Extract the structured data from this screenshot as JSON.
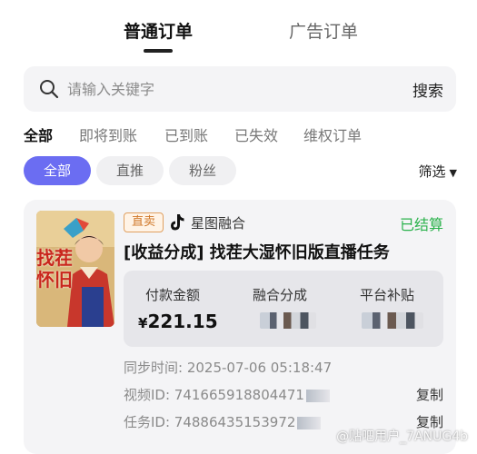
{
  "top_tabs": [
    {
      "label": "普通订单",
      "active": true
    },
    {
      "label": "广告订单",
      "active": false
    }
  ],
  "search": {
    "placeholder": "请输入关键字",
    "button_label": "搜索"
  },
  "status_tabs": [
    {
      "label": "全部",
      "active": true
    },
    {
      "label": "即将到账",
      "active": false
    },
    {
      "label": "已到账",
      "active": false
    },
    {
      "label": "已失效",
      "active": false
    },
    {
      "label": "维权订单",
      "active": false
    }
  ],
  "filter_chips": [
    {
      "label": "全部",
      "active": true
    },
    {
      "label": "直推",
      "active": false
    },
    {
      "label": "粉丝",
      "active": false
    }
  ],
  "filter_button": {
    "label": "筛选"
  },
  "order_card": {
    "tag": "直卖",
    "source": "星图融合",
    "status": "已结算",
    "title": "[收益分成] 找茬大湿怀旧版直播任务",
    "thumbnail_text": "找茬\n怀旧",
    "stats": {
      "payment_label": "付款金额",
      "payment_currency": "¥",
      "payment_value": "221.15",
      "split_label": "融合分成",
      "subsidy_label": "平台补贴"
    },
    "sync_time": "同步时间: 2025-07-06 05:18:47",
    "video_id": "视频ID: 741665918804471",
    "task_id": "任务ID: 74886435153972",
    "copy_label": "复制"
  },
  "watermark": "@贴吧用户_7ANUG4b",
  "colors": {
    "accent": "#6b6df2",
    "status_green": "#2bb24c",
    "tag_orange": "#d0782a"
  }
}
